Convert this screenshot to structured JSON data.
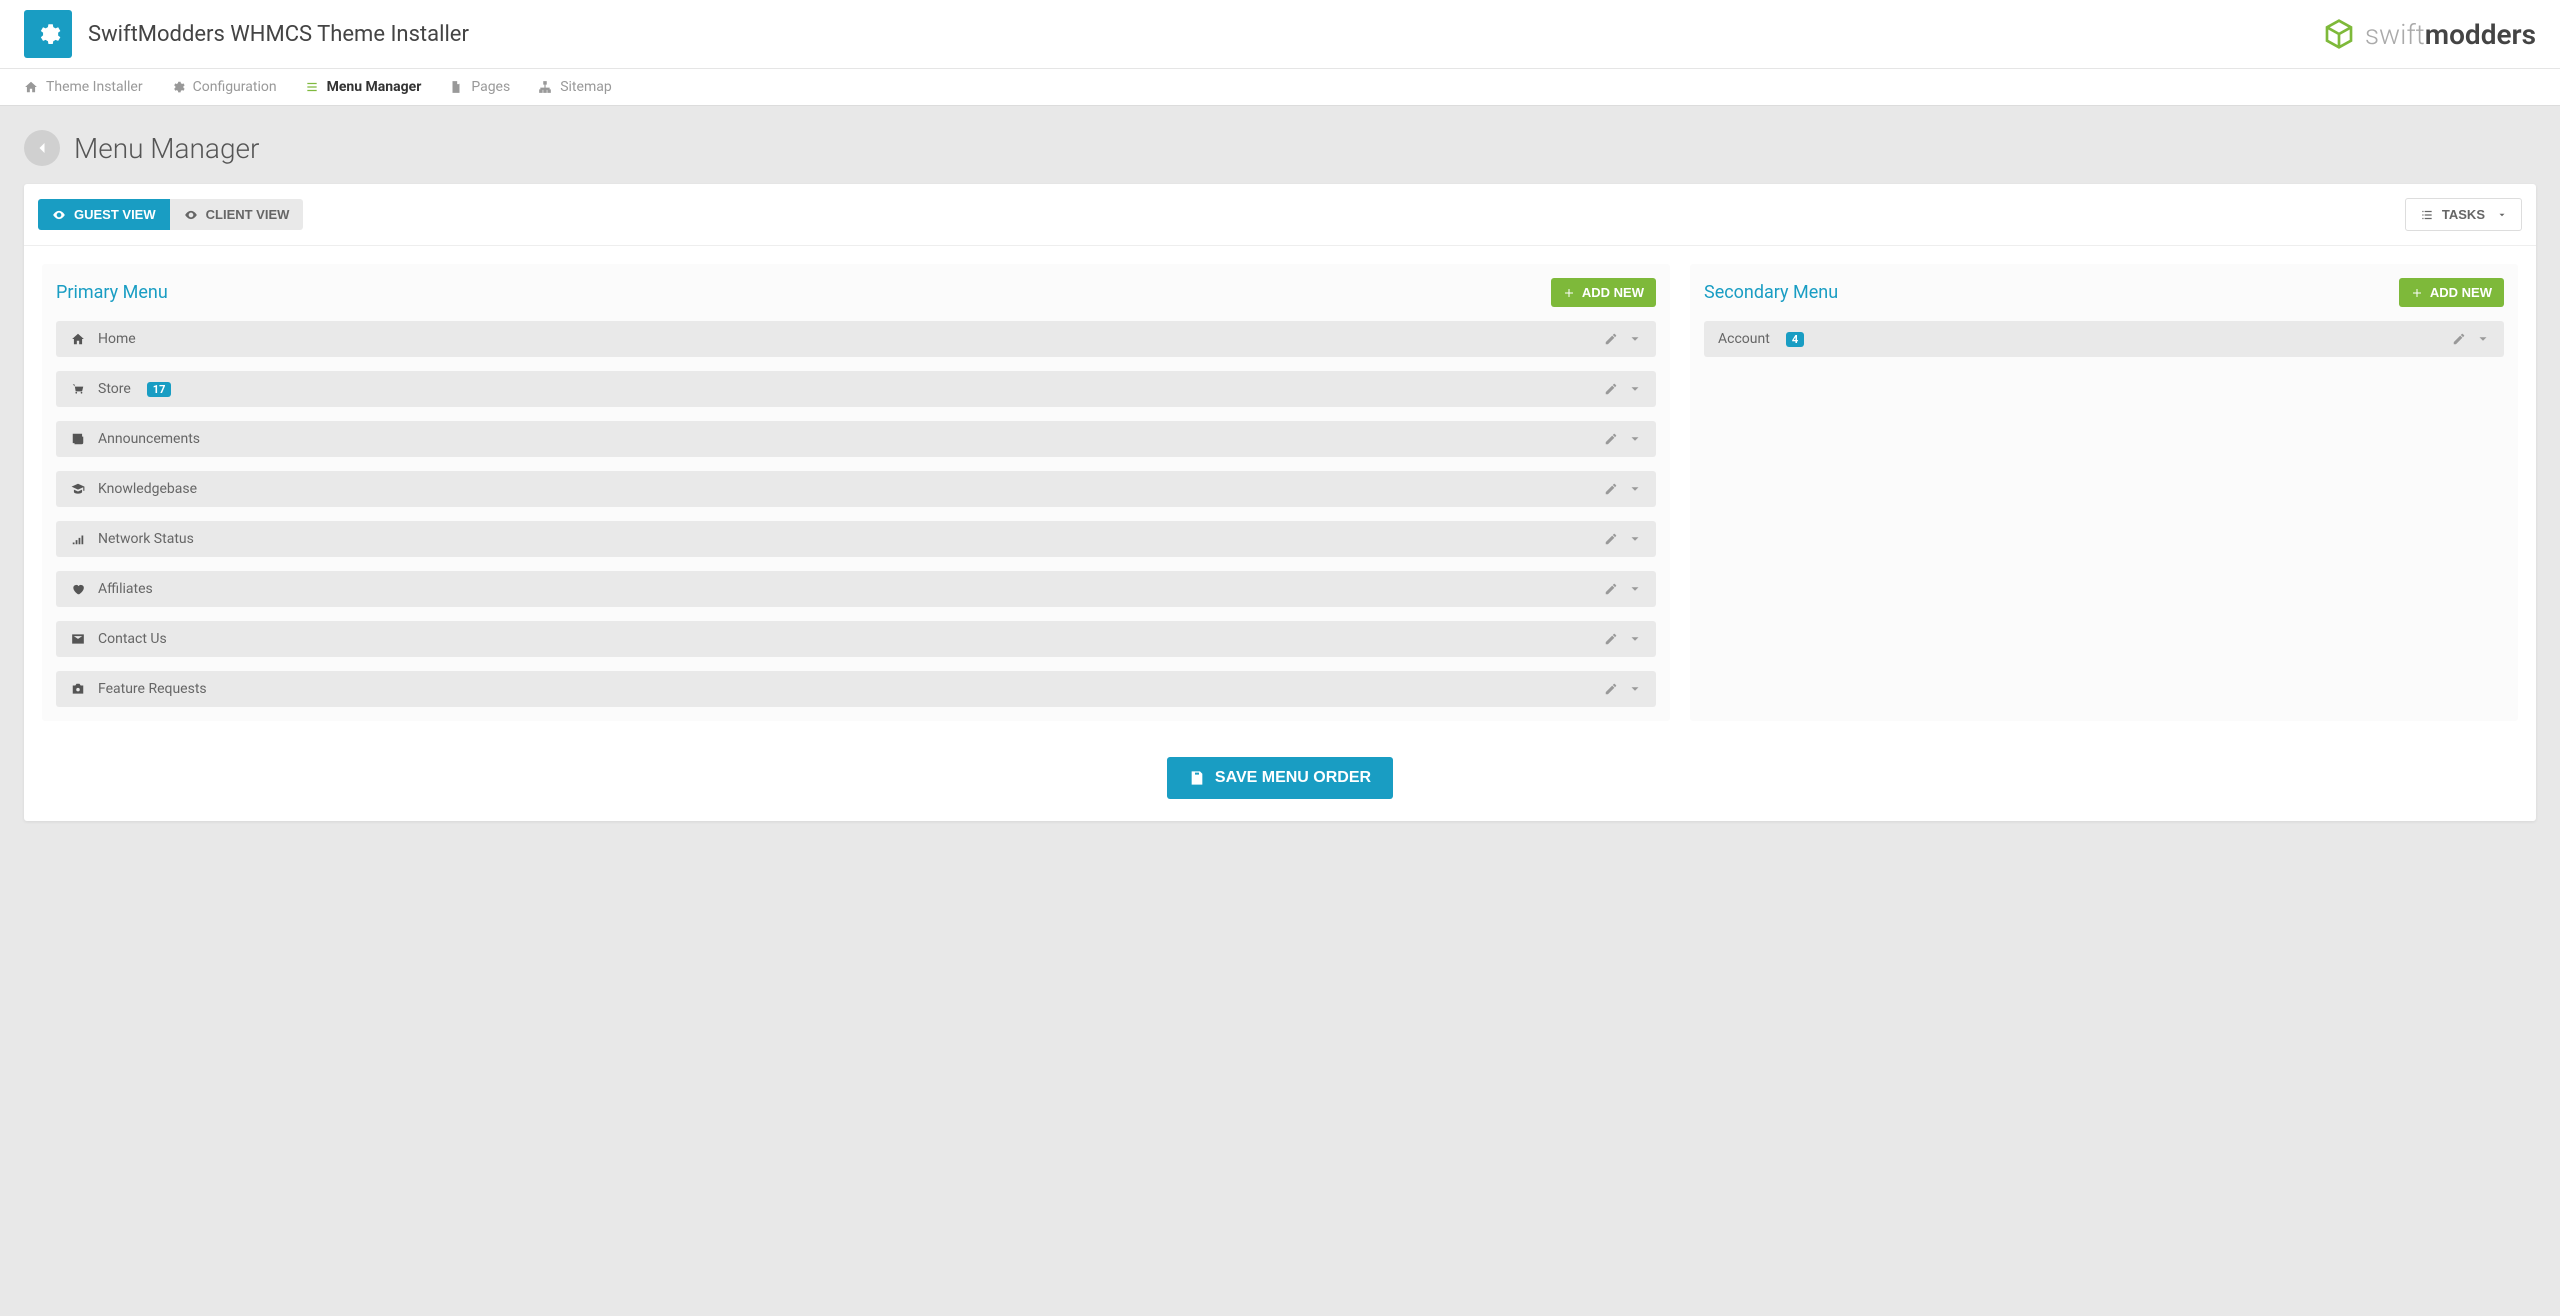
{
  "header": {
    "title": "SwiftModders WHMCS Theme Installer",
    "logo_light": "swift",
    "logo_bold": "modders"
  },
  "nav": {
    "items": [
      {
        "label": "Theme Installer",
        "icon": "home-icon",
        "active": false
      },
      {
        "label": "Configuration",
        "icon": "gear-icon",
        "active": false
      },
      {
        "label": "Menu Manager",
        "icon": "list-icon",
        "active": true
      },
      {
        "label": "Pages",
        "icon": "file-icon",
        "active": false
      },
      {
        "label": "Sitemap",
        "icon": "sitemap-icon",
        "active": false
      }
    ]
  },
  "page": {
    "title": "Menu Manager"
  },
  "toolbar": {
    "guest_view": "GUEST VIEW",
    "client_view": "CLIENT VIEW",
    "tasks": "TASKS"
  },
  "primary_menu": {
    "title": "Primary Menu",
    "add_label": "ADD NEW",
    "items": [
      {
        "label": "Home",
        "icon": "home-icon",
        "badge": null
      },
      {
        "label": "Store",
        "icon": "cart-icon",
        "badge": "17"
      },
      {
        "label": "Announcements",
        "icon": "news-icon",
        "badge": null
      },
      {
        "label": "Knowledgebase",
        "icon": "grad-cap-icon",
        "badge": null
      },
      {
        "label": "Network Status",
        "icon": "signal-icon",
        "badge": null
      },
      {
        "label": "Affiliates",
        "icon": "heart-icon",
        "badge": null
      },
      {
        "label": "Contact Us",
        "icon": "envelope-icon",
        "badge": null
      },
      {
        "label": "Feature Requests",
        "icon": "camera-icon",
        "badge": null
      }
    ]
  },
  "secondary_menu": {
    "title": "Secondary Menu",
    "add_label": "ADD NEW",
    "items": [
      {
        "label": "Account",
        "icon": null,
        "badge": "4"
      }
    ]
  },
  "footer": {
    "save": "SAVE MENU ORDER"
  }
}
